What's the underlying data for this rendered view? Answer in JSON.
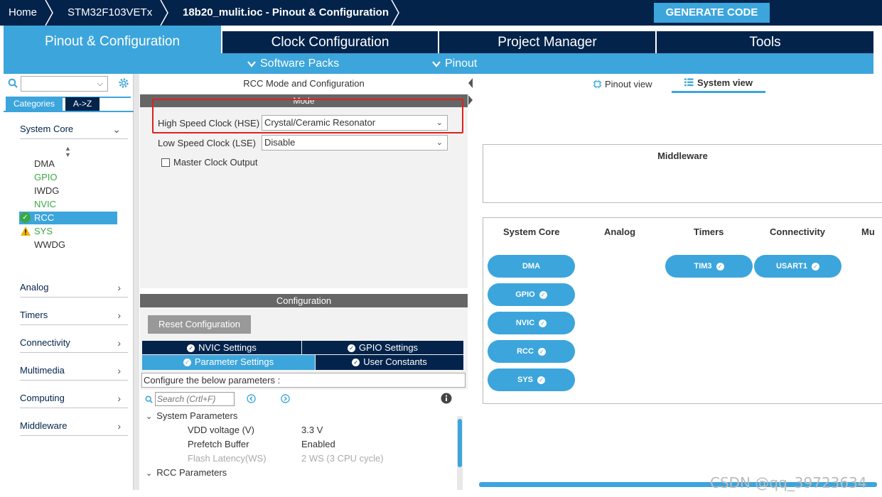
{
  "breadcrumb": {
    "home": "Home",
    "chip": "STM32F103VETx",
    "file": "18b20_mulit.ioc - Pinout & Configuration"
  },
  "generate_code": "GENERATE CODE",
  "tabs": [
    {
      "label": "Pinout & Configuration"
    },
    {
      "label": "Clock Configuration"
    },
    {
      "label": "Project Manager"
    },
    {
      "label": "Tools"
    }
  ],
  "subbar": {
    "software_packs": "Software Packs",
    "pinout": "Pinout"
  },
  "left": {
    "search_value": "",
    "tab_categories": "Categories",
    "tab_az": "A->Z",
    "system_core": "System Core",
    "peripherals": [
      {
        "label": "DMA",
        "color": "#333333",
        "status": ""
      },
      {
        "label": "GPIO",
        "color": "#3aa845",
        "status": ""
      },
      {
        "label": "IWDG",
        "color": "#333333",
        "status": ""
      },
      {
        "label": "NVIC",
        "color": "#3aa845",
        "status": ""
      },
      {
        "label": "RCC",
        "color": "#ffffff",
        "status": "ok"
      },
      {
        "label": "SYS",
        "color": "#3aa845",
        "status": "warning"
      },
      {
        "label": "WWDG",
        "color": "#333333",
        "status": ""
      }
    ],
    "categories": [
      "Analog",
      "Timers",
      "Connectivity",
      "Multimedia",
      "Computing",
      "Middleware"
    ]
  },
  "mode": {
    "title": "RCC Mode and Configuration",
    "section": "Mode",
    "hse_label": "High Speed Clock (HSE)",
    "hse_value": "Crystal/Ceramic Resonator",
    "lse_label": "Low Speed Clock (LSE)",
    "lse_value": "Disable",
    "mco_label": "Master Clock Output"
  },
  "config": {
    "section": "Configuration",
    "reset_button": "Reset Configuration",
    "tabs": {
      "nvic": "NVIC Settings",
      "gpio": "GPIO Settings",
      "param": "Parameter Settings",
      "user": "User Constants"
    },
    "hint": "Configure the below parameters :",
    "search_placeholder": "Search (Crtl+F)",
    "groups": {
      "system": "System Parameters",
      "rcc": "RCC Parameters"
    },
    "params": [
      {
        "name": "VDD voltage (V)",
        "value": "3.3 V",
        "disabled": false
      },
      {
        "name": "Prefetch Buffer",
        "value": "Enabled",
        "disabled": false
      },
      {
        "name": "Flash Latency(WS)",
        "value": "2 WS (3 CPU cycle)",
        "disabled": true
      }
    ]
  },
  "system_view": {
    "pinout_view": "Pinout view",
    "system_view": "System view",
    "middleware": "Middleware",
    "columns": [
      "System Core",
      "Analog",
      "Timers",
      "Connectivity",
      "Mu"
    ],
    "system_core_pills": [
      "DMA",
      "GPIO",
      "NVIC",
      "RCC",
      "SYS"
    ],
    "timers_pills": [
      "TIM3"
    ],
    "connectivity_pills": [
      "USART1"
    ]
  },
  "watermark": "CSDN @qq_39723634",
  "colors": {
    "navy": "#03234b",
    "accent": "#3ca5dc",
    "highlight_box": "#e02020",
    "ok_green": "#3aa845",
    "warning": "#f0b400"
  }
}
